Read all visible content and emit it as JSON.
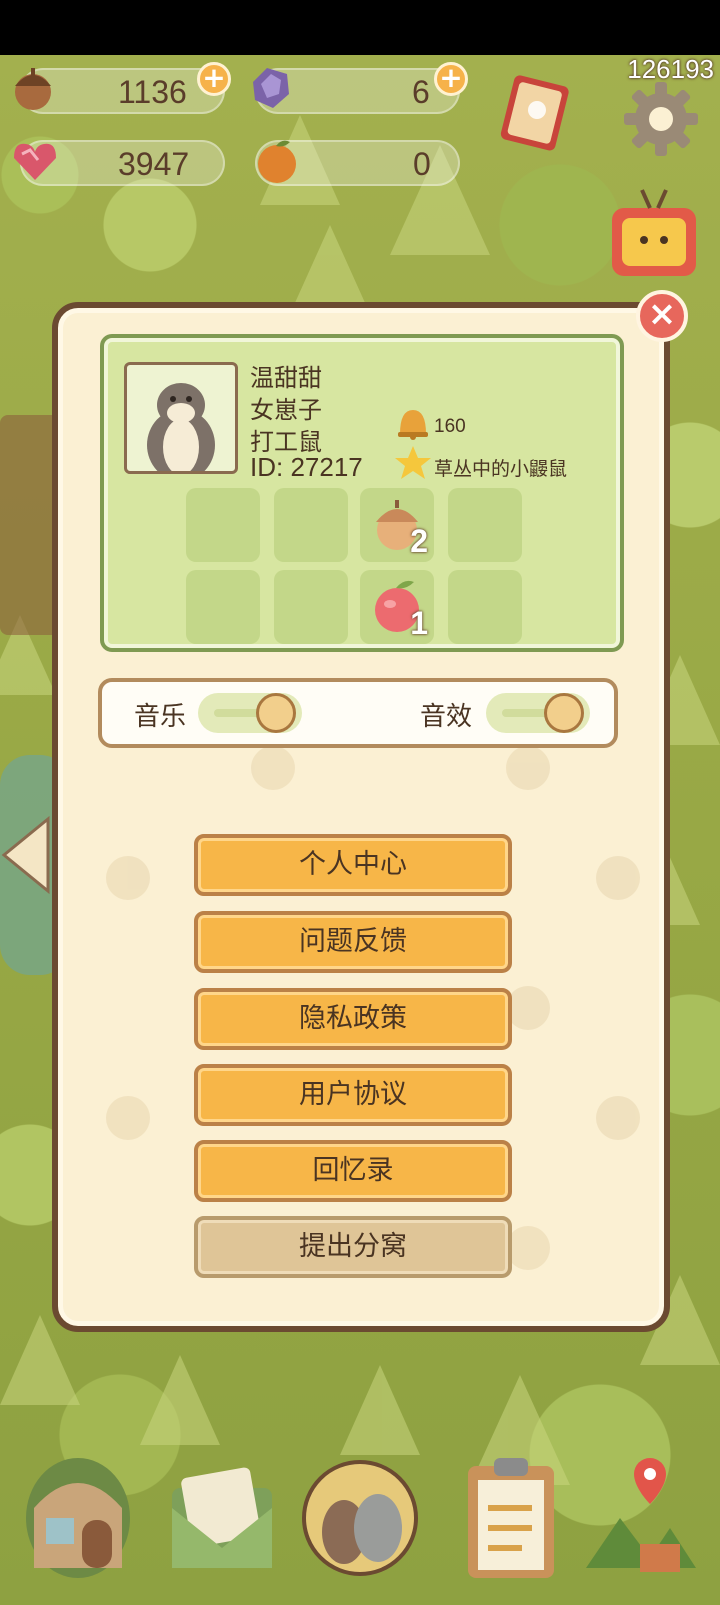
{
  "resources": {
    "acorn": {
      "value": "1136",
      "icon": "acorn-icon"
    },
    "crystal": {
      "value": "6",
      "icon": "crystal-icon"
    },
    "heart_gem": {
      "value": "3947",
      "icon": "heart-gem-icon"
    },
    "orange": {
      "value": "0",
      "icon": "orange-icon"
    }
  },
  "top_id": "126193",
  "profile": {
    "name": "温甜甜",
    "gender": "女崽子",
    "role": "打工鼠",
    "id_text": "ID: 27217",
    "bells": "160",
    "title": "草丛中的小鼹鼠",
    "items": [
      {
        "icon": "acorn-icon",
        "count": "2"
      },
      {
        "icon": "apple-icon",
        "count": "1"
      }
    ]
  },
  "sound": {
    "music_label": "音乐",
    "sfx_label": "音效",
    "music_on": true,
    "sfx_on": true
  },
  "menu": {
    "personal_center": "个人中心",
    "feedback": "问题反馈",
    "privacy_policy": "隐私政策",
    "user_agreement": "用户协议",
    "memoirs": "回忆录",
    "leave_nest": "提出分窝"
  },
  "colors": {
    "primary_button": "#f7b648",
    "secondary_button": "#dfc597",
    "panel": "#fbf0d3",
    "panel_border": "#6b4a31",
    "card": "#d7e6a1",
    "close": "#e7675c"
  }
}
